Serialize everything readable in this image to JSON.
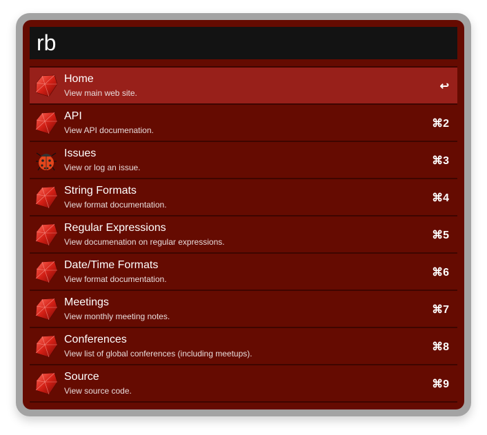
{
  "search": {
    "query": "rb"
  },
  "colors": {
    "panel": "#650b01",
    "selected": "#98201a",
    "search_bg": "#131313"
  },
  "items": [
    {
      "title": "Home",
      "subtitle": "View main web site.",
      "shortcut": "↩",
      "icon": "ruby-icon",
      "selected": true
    },
    {
      "title": "API",
      "subtitle": "View API documenation.",
      "shortcut": "⌘2",
      "icon": "ruby-icon"
    },
    {
      "title": "Issues",
      "subtitle": "View or log an issue.",
      "shortcut": "⌘3",
      "icon": "ladybug-icon"
    },
    {
      "title": "String Formats",
      "subtitle": "View format documentation.",
      "shortcut": "⌘4",
      "icon": "ruby-icon"
    },
    {
      "title": "Regular Expressions",
      "subtitle": "View documenation on regular expressions.",
      "shortcut": "⌘5",
      "icon": "ruby-icon"
    },
    {
      "title": "Date/Time Formats",
      "subtitle": "View format documentation.",
      "shortcut": "⌘6",
      "icon": "ruby-icon"
    },
    {
      "title": "Meetings",
      "subtitle": "View monthly meeting notes.",
      "shortcut": "⌘7",
      "icon": "ruby-icon"
    },
    {
      "title": "Conferences",
      "subtitle": "View list of global conferences (including meetups).",
      "shortcut": "⌘8",
      "icon": "ruby-icon"
    },
    {
      "title": "Source",
      "subtitle": "View source code.",
      "shortcut": "⌘9",
      "icon": "ruby-icon"
    }
  ]
}
